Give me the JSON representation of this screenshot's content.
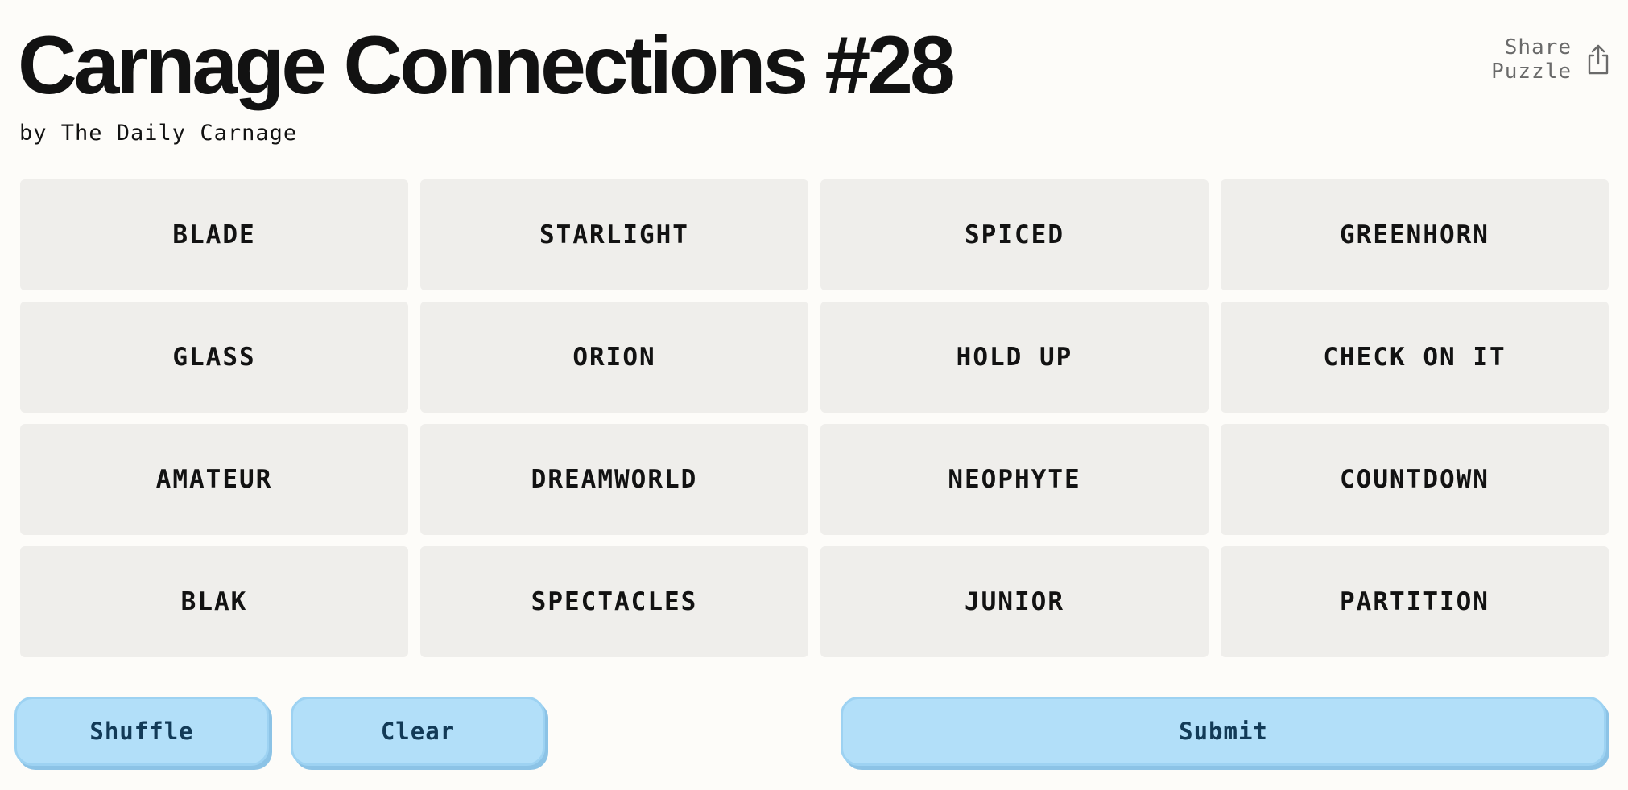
{
  "header": {
    "title": "Carnage Connections #28",
    "byline": "by The Daily Carnage",
    "share_label": "Share\nPuzzle"
  },
  "grid": {
    "tiles": [
      "BLADE",
      "STARLIGHT",
      "SPICED",
      "GREENHORN",
      "GLASS",
      "ORION",
      "HOLD UP",
      "CHECK ON IT",
      "AMATEUR",
      "DREAMWORLD",
      "NEOPHYTE",
      "COUNTDOWN",
      "BLAK",
      "SPECTACLES",
      "JUNIOR",
      "PARTITION"
    ]
  },
  "controls": {
    "shuffle_label": "Shuffle",
    "clear_label": "Clear",
    "submit_label": "Submit"
  },
  "icons": {
    "share": "share-icon"
  },
  "colors": {
    "background": "#fdfcf9",
    "tile": "#efeeeb",
    "button": "#b2dff9",
    "button_border": "#9dd2f2",
    "button_text": "#123a57",
    "text": "#121212",
    "muted": "#6a6a6a"
  }
}
